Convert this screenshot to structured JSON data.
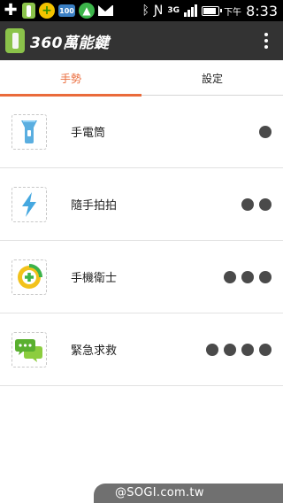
{
  "status_bar": {
    "app3_label": "100",
    "network_label": "3G",
    "battery_level": 0.85,
    "ampm": "下午",
    "time": "8:33"
  },
  "app_bar": {
    "title": "360萬能鍵"
  },
  "tabs": [
    {
      "label": "手勢",
      "active": true
    },
    {
      "label": "設定",
      "active": false
    }
  ],
  "gestures": [
    {
      "label": "手電筒",
      "icon": "flashlight-icon",
      "dots": 1
    },
    {
      "label": "隨手拍拍",
      "icon": "lightning-icon",
      "dots": 2
    },
    {
      "label": "手機衛士",
      "icon": "360-security-icon",
      "dots": 3
    },
    {
      "label": "緊急求救",
      "icon": "chat-bubbles-icon",
      "dots": 4
    }
  ],
  "colors": {
    "accent": "#ea6b3b",
    "app_bar": "#333333",
    "dot": "#4a4a4a"
  },
  "watermark": "@SOGI.com.tw"
}
